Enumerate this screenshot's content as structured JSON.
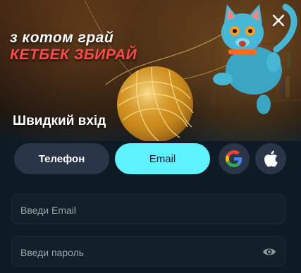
{
  "banner": {
    "line1": "з котом грай",
    "line2": "КЕТБЕК ЗБИРАЙ"
  },
  "title": "Швидкий вхід",
  "tabs": {
    "phone_label": "Телефон",
    "email_label": "Email"
  },
  "social": {
    "google_icon": "google-icon",
    "apple_icon": "apple-icon"
  },
  "form": {
    "email_placeholder": "Введи Email",
    "password_placeholder": "Введи пароль"
  },
  "colors": {
    "accent": "#5ef1ff",
    "banner_red": "#ff4a4a",
    "tab_bg": "#2a3547",
    "background": "#0f1b24"
  }
}
